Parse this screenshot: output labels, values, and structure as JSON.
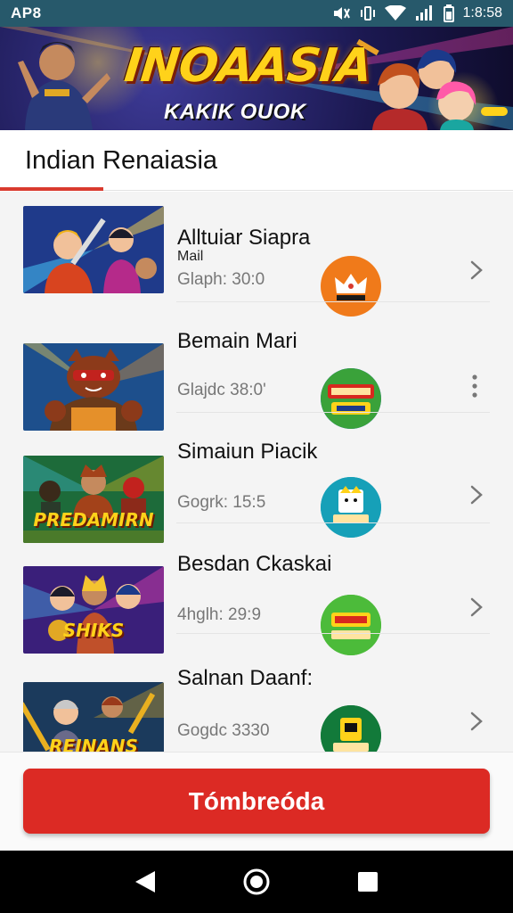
{
  "status_bar": {
    "carrier": "AP8",
    "time": "1:8:58"
  },
  "banner": {
    "title": "INOAASIA",
    "subtitle": "KAKIK OUOK"
  },
  "section": {
    "title": "Indian Renaiasia"
  },
  "items": [
    {
      "title": "Alltuiar Siapra",
      "subtitle": "Mail",
      "meta": "Glaph: 30:0",
      "thumb_text": "",
      "thumb_colors": [
        "#1f3a8a",
        "#d8441f",
        "#f1b21a"
      ],
      "badge_color": "#f07a1a",
      "badge_label": "",
      "action_icon": "chevron-right-icon"
    },
    {
      "title": "Bemain Mari",
      "subtitle": "",
      "meta": "Glajdc 38:0'",
      "thumb_text": "",
      "thumb_colors": [
        "#1d4f8c",
        "#8c3a1a",
        "#e5902a"
      ],
      "badge_color": "#2b6fd6",
      "badge_label": "",
      "action_icon": "more-vertical-icon"
    },
    {
      "title": "Simaiun Piacik",
      "subtitle": "",
      "meta": "Gogrk: 15:5",
      "thumb_text": "PREDAMIRN",
      "thumb_colors": [
        "#1d6b3a",
        "#a3421a",
        "#f0c020"
      ],
      "badge_color": "#16a0b8",
      "badge_label": "",
      "action_icon": "chevron-right-icon"
    },
    {
      "title": "Besdan Ckaskai",
      "subtitle": "",
      "meta": "4hglh: 29:9",
      "thumb_text": "SHIKS",
      "thumb_colors": [
        "#3a1f7a",
        "#c0502a",
        "#f4c430"
      ],
      "badge_color": "#4cbb3a",
      "badge_label": "",
      "action_icon": "chevron-right-icon"
    },
    {
      "title": "Salnan Daanf:",
      "subtitle": "",
      "meta": "Gogdc 3330",
      "thumb_text": "REINANS",
      "thumb_colors": [
        "#1b3a5c",
        "#9a3a1a",
        "#e9b020"
      ],
      "badge_color": "#127a3a",
      "badge_label": "",
      "action_icon": "chevron-right-icon"
    }
  ],
  "cta": {
    "label": "Tómbreóda"
  },
  "colors": {
    "accent": "#dc2a24",
    "status_bar": "#27596b"
  }
}
